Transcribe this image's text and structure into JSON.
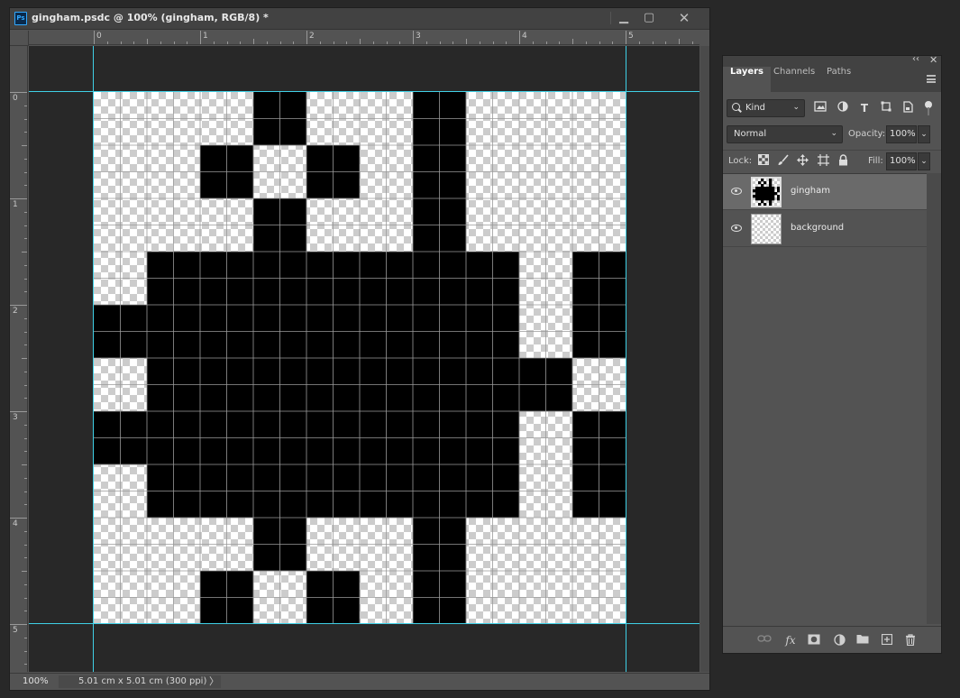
{
  "document": {
    "app_badge": "Ps",
    "title": "gingham.psdc @ 100% (gingham, RGB/8) *",
    "window_buttons": {
      "minimize": "▁",
      "maximize": "▢",
      "close": "✕"
    }
  },
  "rulers": {
    "horizontal": [
      "0",
      "1",
      "2",
      "3",
      "4",
      "5"
    ],
    "vertical": [
      "0",
      "1",
      "2",
      "3",
      "4",
      "5"
    ]
  },
  "status": {
    "zoom": "100%",
    "doc_size": "5.01 cm x 5.01 cm (300 ppi)",
    "arrow": "〉"
  },
  "canvas": {
    "grid_columns": 10,
    "grid_rows": 10,
    "fill_color": "#000000",
    "black_pixels": [
      [
        0,
        3
      ],
      [
        0,
        6
      ],
      [
        1,
        2
      ],
      [
        1,
        4
      ],
      [
        1,
        6
      ],
      [
        2,
        3
      ],
      [
        2,
        6
      ],
      [
        3,
        1
      ],
      [
        3,
        2
      ],
      [
        3,
        3
      ],
      [
        3,
        4
      ],
      [
        3,
        5
      ],
      [
        3,
        6
      ],
      [
        3,
        7
      ],
      [
        3,
        9
      ],
      [
        4,
        0
      ],
      [
        4,
        1
      ],
      [
        4,
        2
      ],
      [
        4,
        3
      ],
      [
        4,
        4
      ],
      [
        4,
        5
      ],
      [
        4,
        6
      ],
      [
        4,
        7
      ],
      [
        4,
        9
      ],
      [
        5,
        1
      ],
      [
        5,
        2
      ],
      [
        5,
        3
      ],
      [
        5,
        4
      ],
      [
        5,
        5
      ],
      [
        5,
        6
      ],
      [
        5,
        7
      ],
      [
        5,
        8
      ],
      [
        6,
        0
      ],
      [
        6,
        1
      ],
      [
        6,
        2
      ],
      [
        6,
        3
      ],
      [
        6,
        4
      ],
      [
        6,
        5
      ],
      [
        6,
        6
      ],
      [
        6,
        7
      ],
      [
        6,
        9
      ],
      [
        7,
        1
      ],
      [
        7,
        2
      ],
      [
        7,
        3
      ],
      [
        7,
        4
      ],
      [
        7,
        5
      ],
      [
        7,
        6
      ],
      [
        7,
        7
      ],
      [
        7,
        9
      ],
      [
        8,
        3
      ],
      [
        8,
        6
      ],
      [
        9,
        2
      ],
      [
        9,
        4
      ],
      [
        9,
        6
      ]
    ],
    "guide_color": "#3fd0e6"
  },
  "layers_panel": {
    "collapse_glyph": "‹‹",
    "close_glyph": "✕",
    "tabs": [
      "Layers",
      "Channels",
      "Paths"
    ],
    "active_tab": "Layers",
    "filter": {
      "kind": "Kind",
      "caret": "⌄"
    },
    "filter_icons": [
      "image-filter-icon",
      "adjustment-filter-icon",
      "type-filter-icon",
      "shape-filter-icon",
      "smart-object-filter-icon"
    ],
    "blend_mode": "Normal",
    "opacity_label": "Opacity:",
    "opacity": "100%",
    "lock_label": "Lock:",
    "fill_label": "Fill:",
    "fill": "100%",
    "layers": [
      {
        "name": "gingham",
        "visible": true,
        "selected": true
      },
      {
        "name": "background",
        "visible": true,
        "selected": false
      }
    ],
    "footer_icons": [
      "link-icon",
      "fx-icon",
      "mask-icon",
      "adjustment-icon",
      "folder-icon",
      "new-layer-icon",
      "trash-icon"
    ],
    "fx_label": "fx"
  }
}
